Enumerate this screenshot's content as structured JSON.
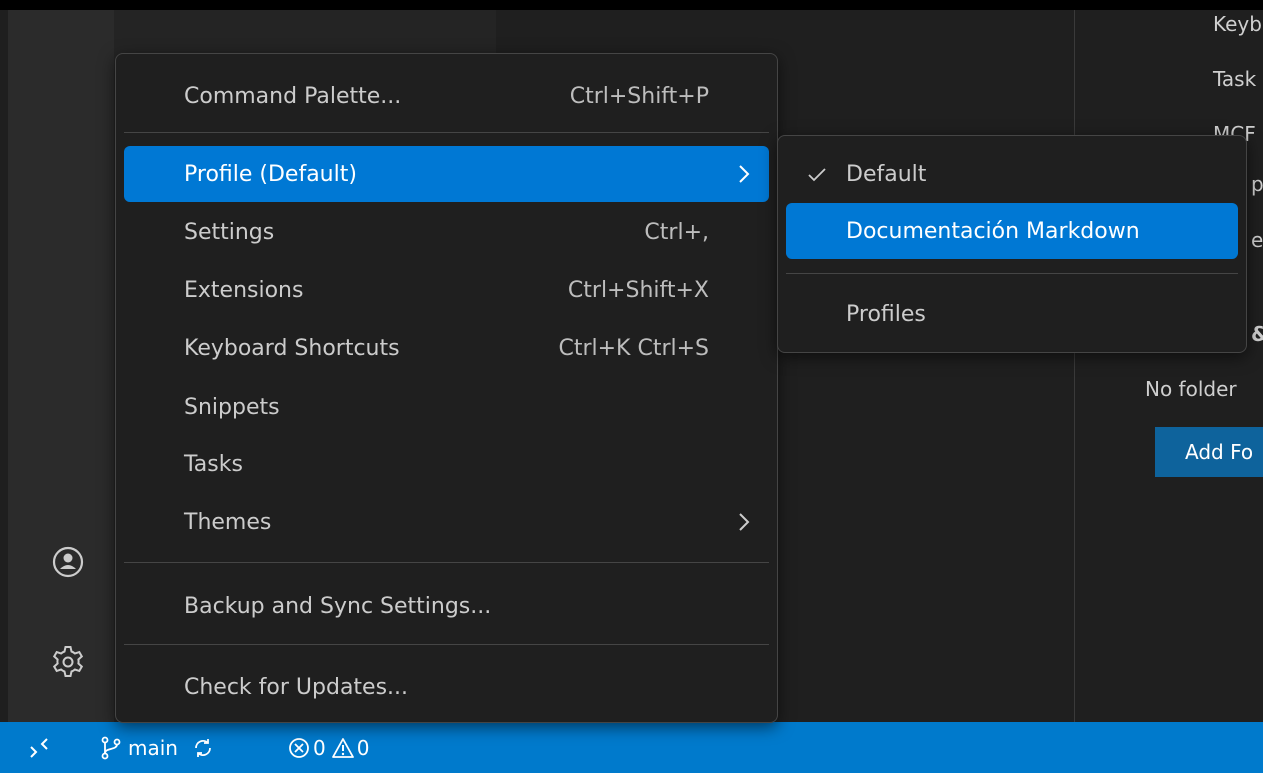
{
  "main_menu": {
    "items": [
      {
        "label": "Command Palette...",
        "shortcut": "Ctrl+Shift+P"
      },
      {
        "label": "Profile (Default)",
        "shortcut": ""
      },
      {
        "label": "Settings",
        "shortcut": "Ctrl+,"
      },
      {
        "label": "Extensions",
        "shortcut": "Ctrl+Shift+X"
      },
      {
        "label": "Keyboard Shortcuts",
        "shortcut": "Ctrl+K Ctrl+S"
      },
      {
        "label": "Snippets",
        "shortcut": ""
      },
      {
        "label": "Tasks",
        "shortcut": ""
      },
      {
        "label": "Themes",
        "shortcut": ""
      },
      {
        "label": "Backup and Sync Settings...",
        "shortcut": ""
      },
      {
        "label": "Check for Updates...",
        "shortcut": ""
      }
    ]
  },
  "profile_submenu": {
    "items": [
      {
        "label": "Default",
        "checked": true
      },
      {
        "label": "Documentación Markdown",
        "checked": false
      },
      {
        "label": "Profiles",
        "checked": false
      }
    ]
  },
  "right_pane": {
    "line1": "Keyb",
    "line2": "Task",
    "line3": "MCF",
    "line4": "p",
    "line5": "e",
    "line6": "&",
    "no_folder": "No folder",
    "add_folder": "Add Fo"
  },
  "status_bar": {
    "branch": "main",
    "errors": "0",
    "warnings": "0"
  },
  "colors": {
    "accent": "#0078d4",
    "status_bar": "#007acc",
    "menu_bg": "#1f1f1f"
  }
}
